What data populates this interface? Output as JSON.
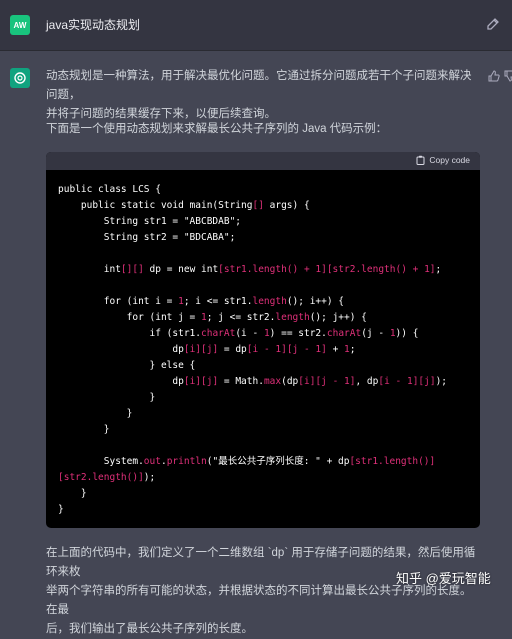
{
  "user": {
    "avatar_initials": "AW",
    "message": "java实现动态规划"
  },
  "assistant": {
    "para1_line1": "动态规划是一种算法，用于解决最优化问题。它通过拆分问题成若干个子问题来解决问题，",
    "para1_line2": "并将子问题的结果缓存下来，以便后续查询。",
    "para2": "下面是一个使用动态规划来求解最长公共子序列的 Java 代码示例：",
    "para3_line1": "在上面的代码中，我们定义了一个二维数组 `dp` 用于存储子问题的结果，然后使用循环来枚",
    "para3_line2": "举两个字符串的所有可能的状态，并根据状态的不同计算出最长公共子序列的长度。在最",
    "para3_line3": "后，我们输出了最长公共子序列的长度。"
  },
  "code": {
    "copy_label": "Copy code",
    "lines": [
      [
        [
          "k",
          "public class LCS {"
        ]
      ],
      [
        [
          "k",
          "    public static void main(String"
        ],
        [
          "r",
          "[]"
        ],
        [
          "k",
          " args) {"
        ]
      ],
      [
        [
          "k",
          "        String str1 = \"ABCBDAB\";"
        ]
      ],
      [
        [
          "k",
          "        String str2 = \"BDCABA\";"
        ]
      ],
      [
        [
          "k",
          ""
        ]
      ],
      [
        [
          "k",
          "        int"
        ],
        [
          "r",
          "[][]"
        ],
        [
          "k",
          " dp = new int"
        ],
        [
          "r",
          "[str1.length() + 1][str2.length() + 1]"
        ],
        [
          "k",
          ";"
        ]
      ],
      [
        [
          "k",
          ""
        ]
      ],
      [
        [
          "k",
          "        for (int i = "
        ],
        [
          "r",
          "1"
        ],
        [
          "k",
          "; i <= str1."
        ],
        [
          "r",
          "length"
        ],
        [
          "k",
          "(); i++) {"
        ]
      ],
      [
        [
          "k",
          "            for (int j = "
        ],
        [
          "r",
          "1"
        ],
        [
          "k",
          "; j <= str2."
        ],
        [
          "r",
          "length"
        ],
        [
          "k",
          "(); j++) {"
        ]
      ],
      [
        [
          "k",
          "                if (str1."
        ],
        [
          "r",
          "charAt"
        ],
        [
          "k",
          "(i - "
        ],
        [
          "r",
          "1"
        ],
        [
          "k",
          ") == str2."
        ],
        [
          "r",
          "charAt"
        ],
        [
          "k",
          "(j - "
        ],
        [
          "r",
          "1"
        ],
        [
          "k",
          ")) {"
        ]
      ],
      [
        [
          "k",
          "                    dp"
        ],
        [
          "r",
          "[i][j]"
        ],
        [
          "k",
          " = dp"
        ],
        [
          "r",
          "[i - 1][j - 1]"
        ],
        [
          "k",
          " + "
        ],
        [
          "r",
          "1"
        ],
        [
          "k",
          ";"
        ]
      ],
      [
        [
          "k",
          "                } else {"
        ]
      ],
      [
        [
          "k",
          "                    dp"
        ],
        [
          "r",
          "[i][j]"
        ],
        [
          "k",
          " = Math."
        ],
        [
          "r",
          "max"
        ],
        [
          "k",
          "(dp"
        ],
        [
          "r",
          "[i][j - 1]"
        ],
        [
          "k",
          ", dp"
        ],
        [
          "r",
          "[i - 1][j]"
        ],
        [
          "k",
          ");"
        ]
      ],
      [
        [
          "k",
          "                }"
        ]
      ],
      [
        [
          "k",
          "            }"
        ]
      ],
      [
        [
          "k",
          "        }"
        ]
      ],
      [
        [
          "k",
          ""
        ]
      ],
      [
        [
          "k",
          "        System."
        ],
        [
          "r",
          "out"
        ],
        [
          "k",
          "."
        ],
        [
          "r",
          "println"
        ],
        [
          "k",
          "(\"最长公共子序列长度: \" + dp"
        ],
        [
          "r",
          "[str1.length()]"
        ]
      ],
      [
        [
          "r",
          "[str2.length()]"
        ],
        [
          "k",
          ");"
        ]
      ],
      [
        [
          "k",
          "    }"
        ]
      ],
      [
        [
          "k",
          "}"
        ]
      ]
    ]
  },
  "watermark": "知乎 @爱玩智能"
}
